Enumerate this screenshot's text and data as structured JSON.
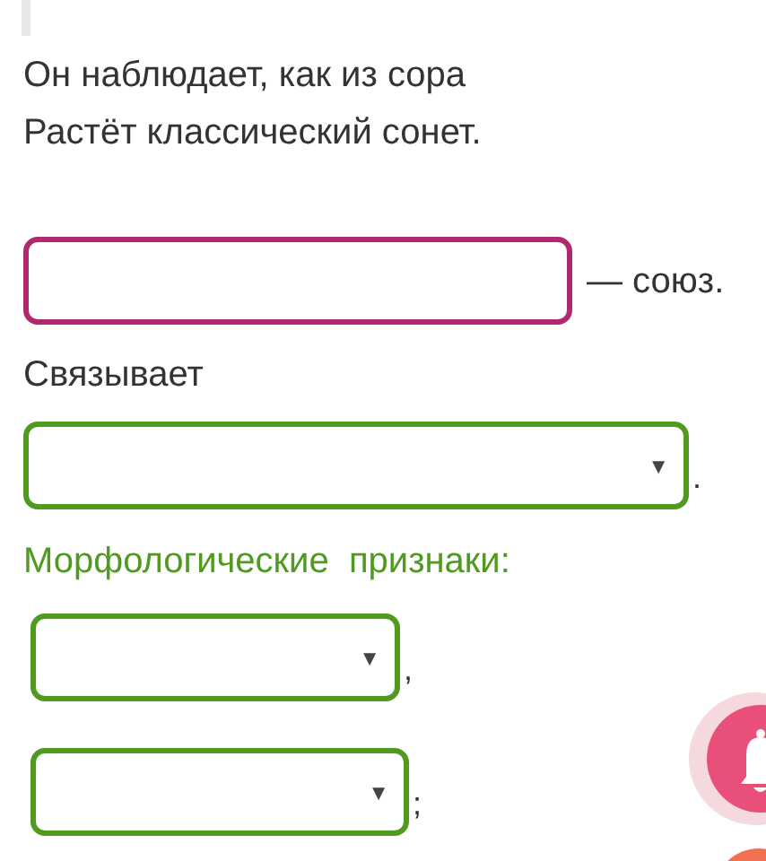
{
  "poem": [
    "Он наблюдает, как из сора",
    "Растёт классический сонет."
  ],
  "blanks": [
    {
      "kind": "input",
      "suffix": "— союз.",
      "highlighted": true
    }
  ],
  "label": "Связывает",
  "selects": [
    {
      "arrow": "▼",
      "suffix": "."
    }
  ],
  "heading": "Морфологические  признаки:",
  "features": [
    {
      "arrow": "▼",
      "suffix": ","
    },
    {
      "arrow": "▼",
      "suffix": ";"
    }
  ]
}
